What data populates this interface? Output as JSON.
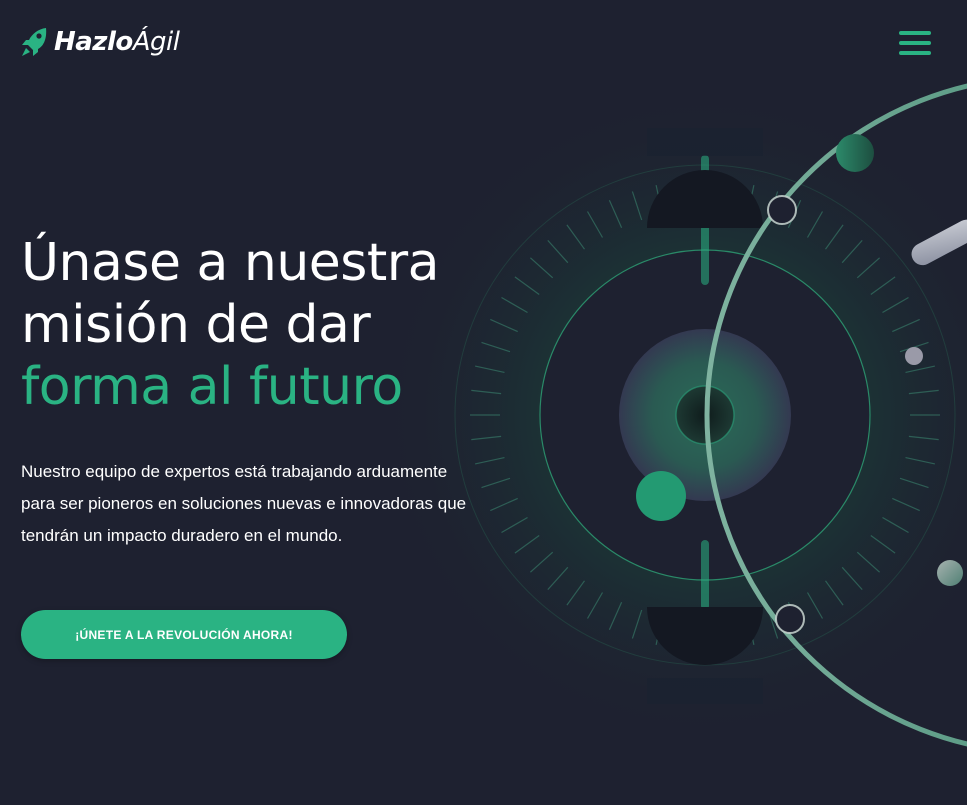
{
  "brand": {
    "name_bold": "Hazlo",
    "name_light": "Ágil",
    "accent_color": "#2ab383",
    "background_color": "#1e2130",
    "logo_icon": "rocket-icon"
  },
  "header": {
    "menu_icon": "hamburger-menu-icon"
  },
  "hero": {
    "title_line1": "Únase a nuestra",
    "title_line2": "misión de dar",
    "title_line3": "forma al futuro",
    "description": "Nuestro equipo de expertos está trabajando arduamente para ser pioneros en soluciones nuevas e innovadoras que tendrán un impacto duradero en el mundo.",
    "cta_label": "¡ÚNETE A LA REVOLUCIÓN AHORA!"
  }
}
